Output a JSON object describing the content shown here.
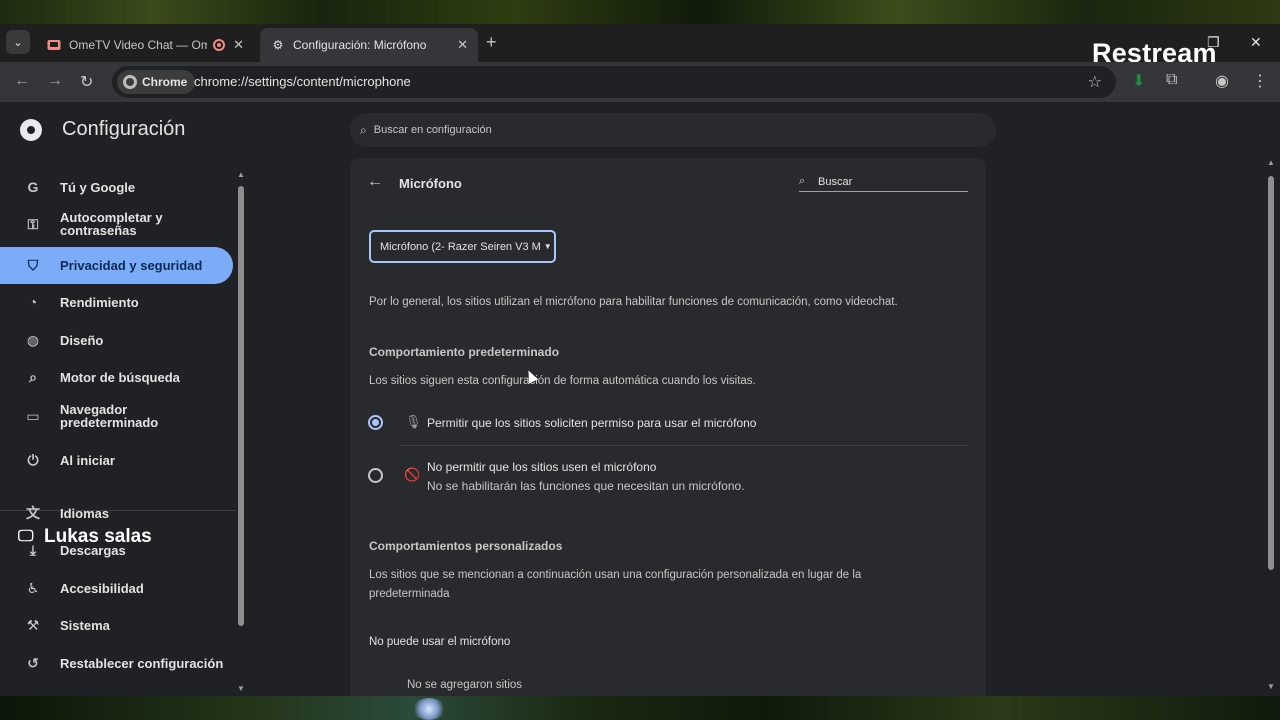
{
  "tabs": [
    {
      "title": "OmeTV Video Chat — Ome",
      "favicon": "video-chat-favicon",
      "recording": true
    },
    {
      "title": "Configuración: Micrófono",
      "favicon": "gear-icon"
    }
  ],
  "overlay": {
    "brand": "Restream",
    "streamer": "Lukas salas"
  },
  "omnibox": {
    "chip": "Chrome",
    "url": "chrome://settings/content/microphone"
  },
  "settings": {
    "title": "Configuración",
    "search_placeholder": "Buscar en configuración"
  },
  "sidebar": {
    "items": [
      {
        "label": "Tú y Google",
        "icon": "google-icon"
      },
      {
        "label": "Autocompletar y contraseñas",
        "icon": "key-icon"
      },
      {
        "label": "Privacidad y seguridad",
        "icon": "shield-icon",
        "selected": true
      },
      {
        "label": "Rendimiento",
        "icon": "speedometer-icon"
      },
      {
        "label": "Diseño",
        "icon": "palette-icon"
      },
      {
        "label": "Motor de búsqueda",
        "icon": "search-icon"
      },
      {
        "label": "Navegador predeterminado",
        "icon": "browser-window-icon"
      },
      {
        "label": "Al iniciar",
        "icon": "power-icon"
      },
      {
        "label": "Idiomas",
        "icon": "translate-icon"
      },
      {
        "label": "Descargas",
        "icon": "download-icon"
      },
      {
        "label": "Accesibilidad",
        "icon": "accessibility-icon"
      },
      {
        "label": "Sistema",
        "icon": "wrench-icon"
      },
      {
        "label": "Restablecer configuración",
        "icon": "reset-icon"
      }
    ]
  },
  "main": {
    "section_title": "Micrófono",
    "search_placeholder": "Buscar",
    "device_select": "Micrófono (2- Razer Seiren V3 M",
    "description": "Por lo general, los sitios utilizan el micrófono para habilitar funciones de comunicación, como videochat.",
    "default_heading": "Comportamiento predeterminado",
    "default_desc": "Los sitios siguen esta configuración de forma automática cuando los visitas.",
    "option_allow": "Permitir que los sitios soliciten permiso para usar el micrófono",
    "option_block": "No permitir que los sitios usen el micrófono",
    "option_block_sub": "No se habilitarán las funciones que necesitan un micrófono.",
    "selected_option": "allow",
    "custom_heading": "Comportamientos personalizados",
    "custom_desc_1": "Los sitios que se mencionan a continuación usan una configuración personalizada en lugar de la",
    "custom_desc_2": "predeterminada",
    "blocked_heading": "No puede usar el micrófono",
    "blocked_empty": "No se agregaron sitios"
  },
  "colors": {
    "accent": "#7cacf8",
    "window_bg": "#202124",
    "card_bg": "#292a2d"
  }
}
